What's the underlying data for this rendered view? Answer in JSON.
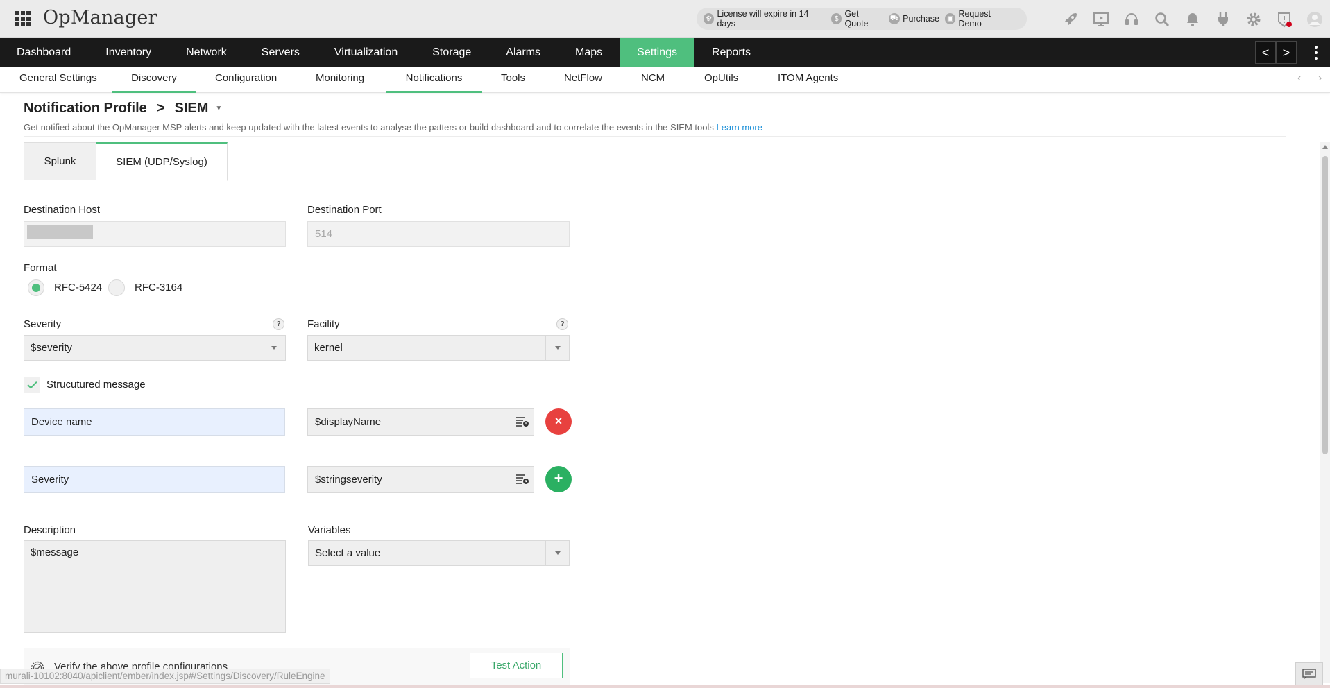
{
  "app": {
    "title": "OpManager"
  },
  "promo": {
    "license": "License will expire in 14 days",
    "get_quote": "Get Quote",
    "purchase": "Purchase",
    "request_demo": "Request Demo"
  },
  "toolbar_icons": [
    "rocket-icon",
    "presentation-icon",
    "headset-icon",
    "search-icon",
    "bell-icon",
    "plug-icon",
    "gear-icon",
    "shield-alert-icon",
    "user-avatar-icon"
  ],
  "main_nav": {
    "items": [
      "Dashboard",
      "Inventory",
      "Network",
      "Servers",
      "Virtualization",
      "Storage",
      "Alarms",
      "Maps",
      "Settings",
      "Reports"
    ],
    "active": "Settings",
    "prev_arrow": "<",
    "next_arrow": ">"
  },
  "sub_nav": {
    "items": [
      "General Settings",
      "Discovery",
      "Configuration",
      "Monitoring",
      "Notifications",
      "Tools",
      "NetFlow",
      "NCM",
      "OpUtils",
      "ITOM Agents"
    ],
    "active": [
      "Discovery",
      "Notifications"
    ],
    "prev_arrow": "‹",
    "next_arrow": "›"
  },
  "breadcrumb": {
    "parent": "Notification Profile",
    "separator": ">",
    "current": "SIEM"
  },
  "description": {
    "text": "Get notified about the OpManager MSP alerts and keep updated with the latest events to analyse the patters or build dashboard and to correlate the events in the SIEM tools ",
    "link": "Learn more"
  },
  "tabs": [
    "Splunk",
    "SIEM (UDP/Syslog)"
  ],
  "active_tab": "SIEM (UDP/Syslog)",
  "form": {
    "destination_host_label": "Destination Host",
    "destination_port_label": "Destination Port",
    "destination_port_value": "514",
    "format_label": "Format",
    "format_options": [
      "RFC-5424",
      "RFC-3164"
    ],
    "format_selected": "RFC-5424",
    "severity_label": "Severity",
    "severity_value": "$severity",
    "facility_label": "Facility",
    "facility_value": "kernel",
    "help_glyph": "?",
    "structured_label": "Strucutured message",
    "structured_checked": true,
    "kv_rows": [
      {
        "key": "Device name",
        "value": "$displayName",
        "action": "remove",
        "action_glyph": "×"
      },
      {
        "key": "Severity",
        "value": "$stringseverity",
        "action": "add",
        "action_glyph": "+"
      }
    ],
    "description_label": "Description",
    "description_value": "$message",
    "variables_label": "Variables",
    "variables_placeholder": "Select a value"
  },
  "verify": {
    "text": "Verify the above profile configurations.",
    "button": "Test Action"
  },
  "status_url": "murali-10102:8040/apiclient/ember/index.jsp#/Settings/Discovery/RuleEngine",
  "colors": {
    "accent": "#4fbf7e",
    "nav_bg": "#1a1a1a",
    "remove": "#e8413f",
    "add": "#2bb062",
    "link": "#1a8fd8"
  }
}
